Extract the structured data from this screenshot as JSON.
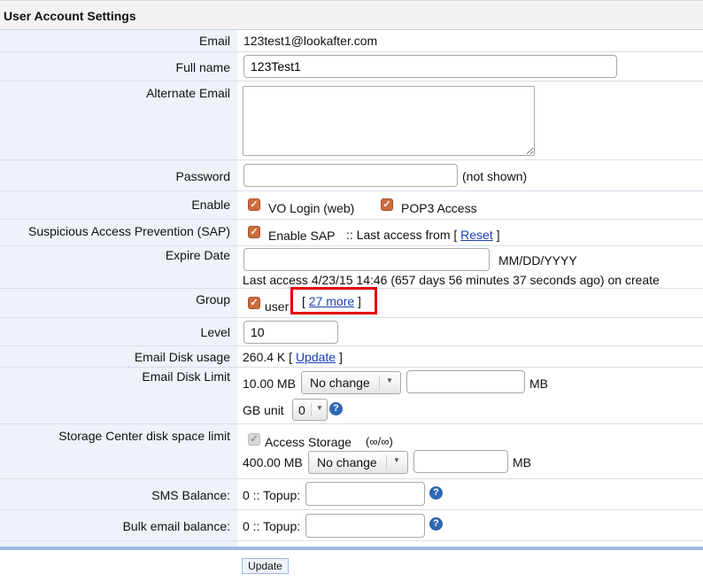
{
  "title": "User Account Settings",
  "labels": {
    "email": "Email",
    "full_name": "Full name",
    "alternate_email": "Alternate Email",
    "password": "Password",
    "enable": "Enable",
    "sap": "Suspicious Access Prevention (SAP)",
    "expire_date": "Expire Date",
    "group": "Group",
    "level": "Level",
    "email_disk_usage": "Email Disk usage",
    "email_disk_limit": "Email Disk Limit",
    "storage_limit": "Storage Center disk space limit",
    "sms_balance": "SMS Balance:",
    "bulk_email_balance": "Bulk email balance:"
  },
  "fields": {
    "email_value": "123test1@lookafter.com",
    "full_name_value": "123Test1",
    "alternate_email_value": "",
    "password_value": "",
    "password_note": "(not shown)",
    "enable_vo_login": "VO Login (web)",
    "enable_pop3": "POP3 Access",
    "sap_enable": "Enable SAP",
    "sap_last_access_prefix": ":: Last access from [",
    "sap_reset": "Reset",
    "bracket_close": "]",
    "expire_value": "",
    "expire_format": "MM/DD/YYYY",
    "last_access": "Last access 4/23/15 14:46 (657 days 56 minutes 37 seconds ago) on create",
    "group_user": "user",
    "group_more_open": "[",
    "group_more_link": "27 more",
    "group_more_close": "]",
    "level_value": "10",
    "disk_usage_value": "260.4 K [",
    "disk_usage_update": "Update",
    "disk_limit_value": "10.00 MB",
    "disk_limit_select": "No change",
    "disk_limit_input": "",
    "disk_limit_unit": "MB",
    "gb_unit_label": "GB unit",
    "gb_unit_select": "0",
    "storage_access": "Access Storage",
    "storage_quota": "(∞/∞)",
    "storage_value": "400.00 MB",
    "storage_select": "No change",
    "storage_input": "",
    "storage_unit": "MB",
    "sms_prefix": "0 :: Topup:",
    "sms_input": "",
    "bulk_prefix": "0 :: Topup:",
    "bulk_input": ""
  },
  "buttons": {
    "update": "Update"
  },
  "colors": {
    "highlight": "#e1000b",
    "checkbox": "#cd6b3c",
    "link": "#1a3fb5",
    "help": "#2f67b1"
  }
}
